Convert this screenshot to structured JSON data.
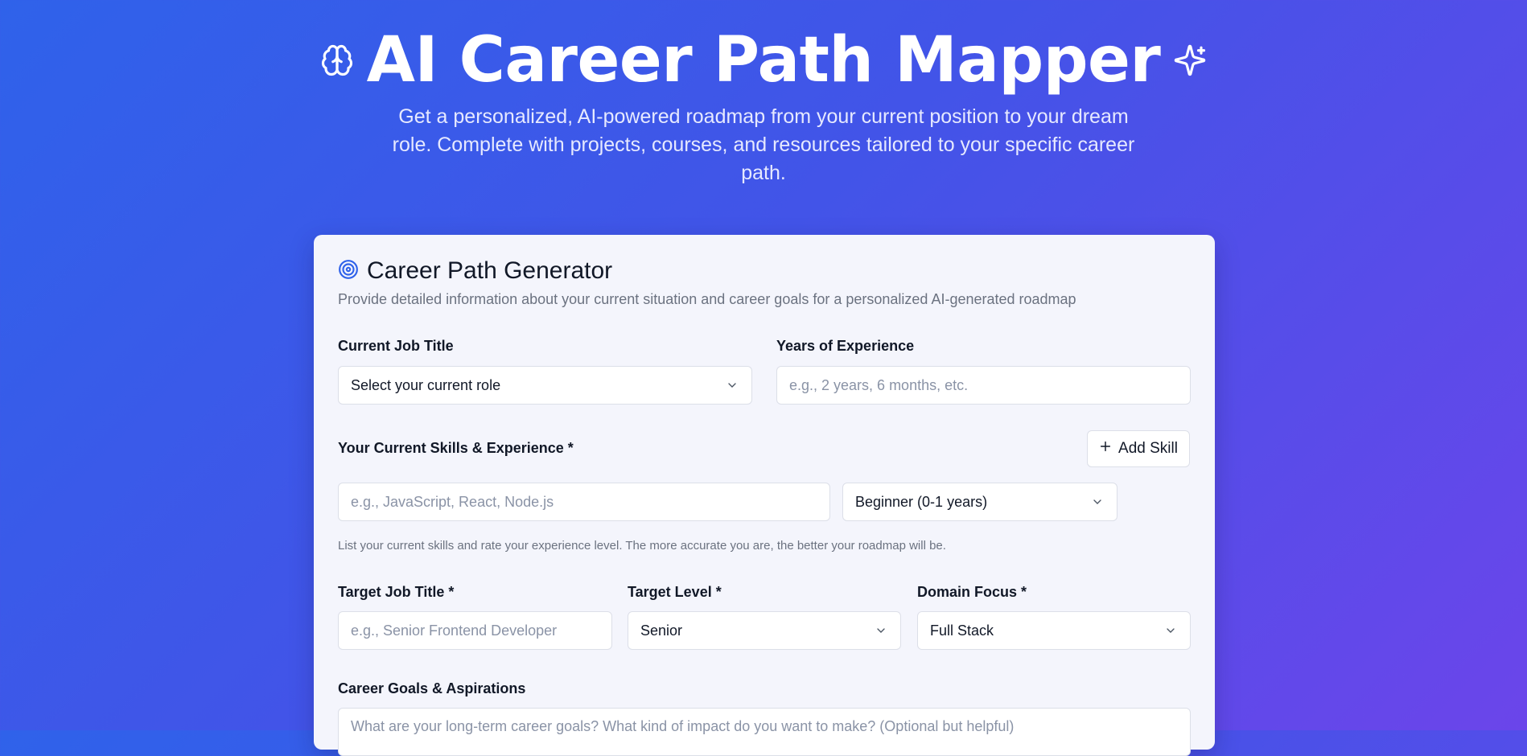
{
  "hero": {
    "title": "AI Career Path Mapper",
    "subtitle": "Get a personalized, AI-powered roadmap from your current position to your dream role. Complete with projects, courses, and resources tailored to your specific career path.",
    "left_icon": "brain-icon",
    "right_icon": "sparkles-icon"
  },
  "card": {
    "icon": "target-icon",
    "title": "Career Path Generator",
    "description": "Provide detailed information about your current situation and career goals for a personalized AI-generated roadmap"
  },
  "form": {
    "current_job": {
      "label": "Current Job Title",
      "value": "Select your current role"
    },
    "experience": {
      "label": "Years of Experience",
      "placeholder": "e.g., 2 years, 6 months, etc."
    },
    "skills": {
      "label": "Your Current Skills & Experience *",
      "add_label": "Add Skill",
      "skill_placeholder": "e.g., JavaScript, React, Node.js",
      "level_value": "Beginner (0-1 years)",
      "hint": "List your current skills and rate your experience level. The more accurate you are, the better your roadmap will be."
    },
    "target_job": {
      "label": "Target Job Title *",
      "placeholder": "e.g., Senior Frontend Developer"
    },
    "target_level": {
      "label": "Target Level *",
      "value": "Senior"
    },
    "domain": {
      "label": "Domain Focus *",
      "value": "Full Stack"
    },
    "goals": {
      "label": "Career Goals & Aspirations",
      "placeholder": "What are your long-term career goals? What kind of impact do you want to make? (Optional but helpful)"
    }
  },
  "colors": {
    "gradient_start": "#2f62ea",
    "gradient_end": "#6b45ea",
    "card_bg": "#f4f5fc",
    "accent": "#2f62ea"
  }
}
